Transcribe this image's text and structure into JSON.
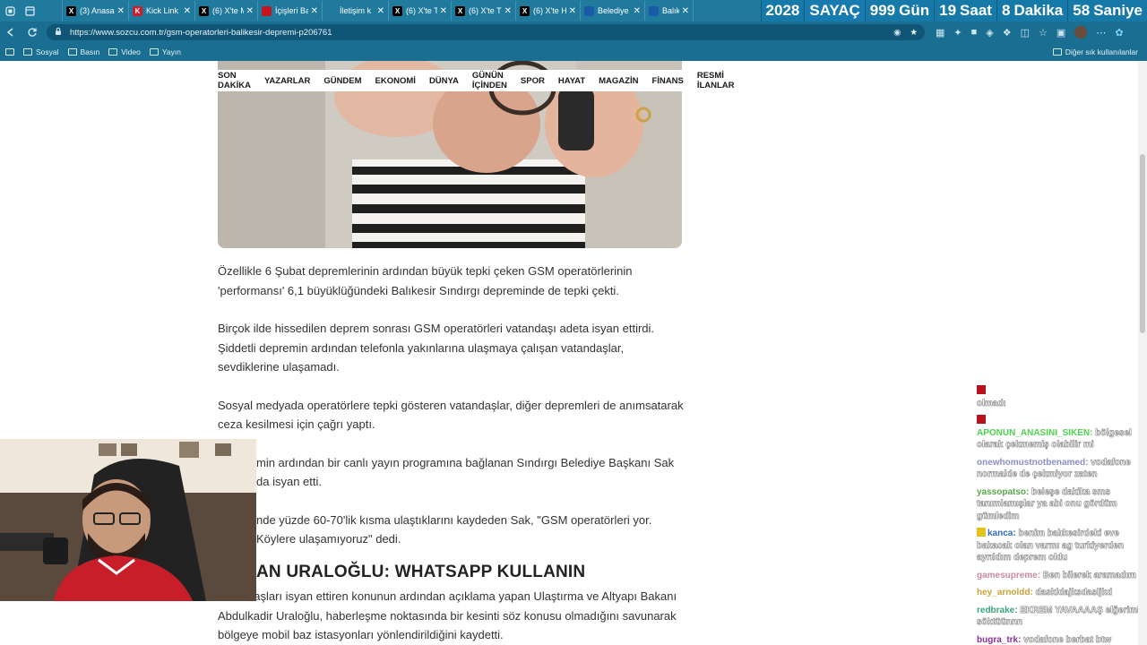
{
  "browser": {
    "tabs": [
      {
        "label": "",
        "icon": "pin-icon",
        "color": "#1f7a9e"
      },
      {
        "label": "(3) Anasa",
        "icon": "x-logo-icon",
        "color": "#000000"
      },
      {
        "label": "Kick Link",
        "icon": "kick-icon",
        "color": "#d11a2a"
      },
      {
        "label": "(6) X'te M",
        "icon": "x-logo-icon",
        "color": "#000000"
      },
      {
        "label": "İçişleri Ba",
        "icon": "news-icon",
        "color": "#c4161c"
      },
      {
        "label": "İletişim k",
        "icon": "page-icon",
        "color": "#1f7a9e"
      },
      {
        "label": "(6) X'te T",
        "icon": "x-logo-icon",
        "color": "#000000"
      },
      {
        "label": "(6) X'te T",
        "icon": "x-logo-icon",
        "color": "#000000"
      },
      {
        "label": "(6) X'te H",
        "icon": "x-logo-icon",
        "color": "#000000"
      },
      {
        "label": "Belediye",
        "icon": "news-icon",
        "color": "#1b5aa6"
      },
      {
        "label": "Balıkesir",
        "icon": "news-icon",
        "color": "#1b5aa6"
      }
    ],
    "url": "https://www.sozcu.com.tr/gsm-operatorleri-balikesir-depremi-p206761",
    "bookmarks": [
      "Sosyal",
      "Basın",
      "Video",
      "Yayın"
    ],
    "other_bookmarks": "Diğer sık kullanılanlar"
  },
  "counter": {
    "year": "2028",
    "title": "SAYAÇ",
    "days_value": "999",
    "days_label": "Gün",
    "hours_value": "19",
    "hours_label": "Saat",
    "minutes_value": "8",
    "minutes_label": "Dakika",
    "seconds_value": "58",
    "seconds_label": "Saniye"
  },
  "nav": [
    "SON DAKİKA",
    "YAZARLAR",
    "GÜNDEM",
    "EKONOMİ",
    "DÜNYA",
    "GÜNÜN İÇİNDEN",
    "SPOR",
    "HAYAT",
    "MAGAZİN",
    "FİNANS",
    "RESMİ İLANLAR"
  ],
  "article": {
    "p1": "Özellikle 6 Şubat depremlerinin ardından büyük tepki çeken GSM operatörlerinin 'performansı' 6,1 büyüklüğündeki Balıkesir Sındırgı depreminde de tepki çekti.",
    "p2": "Birçok ilde hissedilen deprem sonrası GSM operatörleri vatandaşı adeta isyan ettirdi. Şiddetli depremin ardından telefonla yakınlarına ulaşmaya çalışan vatandaşlar, sevdiklerine ulaşamadı.",
    "p3": "Sosyal medyada operatörlere tepki gösteren vatandaşlar, diğer depremleri de anımsatarak ceza kesilmesi için çağrı yaptı.",
    "p4": "min ardından bir canlı yayın programına bağlanan Sındırgı Belediye Başkanı Sak da isyan etti.",
    "p5": "nde yüzde 60-70'lik kısma ulaştıklarını kaydeden Sak, \"GSM operatörleri yor. Köylere ulaşamıyoruz\" dedi.",
    "subhead": "AN URALOĞLU: WHATSAPP KULLANIN",
    "p6": "Vatandaşları isyan ettiren konunun ardından açıklama yapan Ulaştırma ve Altyapı Bakanı Abdulkadir Uraloğlu, haberleşme noktasında bir kesinti söz konusu olmadığını savunarak bölgeye mobil baz istasyonları yönlendirildiğini kaydetti."
  },
  "chat": [
    {
      "user": "",
      "text": "olmadı",
      "color": "#b5121b"
    },
    {
      "user": "APONUN_ANASINI_SIKEN",
      "text": "bölgesel olarak çekmemiş olabilir mi",
      "color": "#4fd04f"
    },
    {
      "user": "onewhomustnotbenamed",
      "text": "vodafone normalde de çekmiyor zaten",
      "color": "#8a8ec9"
    },
    {
      "user": "yassopatso",
      "text": "beleşe dakika sms tanımlamışlar ya abi onu gördüm gümledim",
      "color": "#5aa64a"
    },
    {
      "user": "kanca",
      "text": "benim balıkesirdeki eve bakacak olan varmı ag turkiyerden ayrıldım deprem oldu",
      "color": "#2f6cc4"
    },
    {
      "user": "gamesupreme",
      "text": "Ben bilerek aramadım",
      "color": "#c78aa0"
    },
    {
      "user": "hey_arnoldd",
      "text": "daskldajksdasljkd",
      "color": "#c9a23a"
    },
    {
      "user": "redbrake",
      "text": "EKREM YAVAAAAŞ elğerimi söktüünnn",
      "color": "#3aa67a"
    },
    {
      "user": "bugra_trk",
      "text": "vodafone berbat btw",
      "color": "#8a2f9a"
    }
  ],
  "colors": {
    "tabbar": "#1f7a9e",
    "counter": "#1779a8",
    "text": "#333333"
  }
}
